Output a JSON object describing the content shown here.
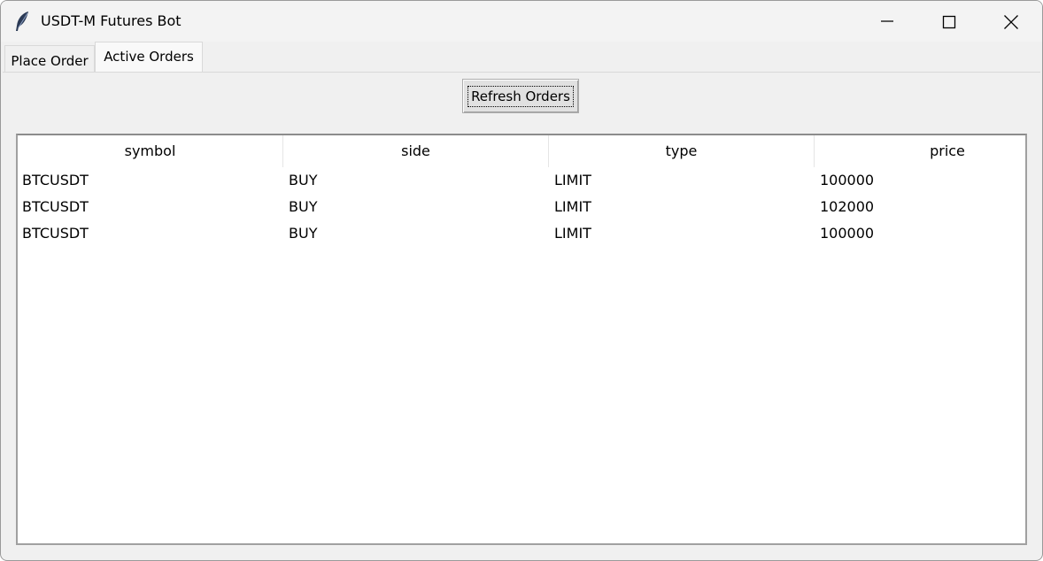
{
  "window": {
    "title": "USDT-M Futures Bot",
    "icon": "feather-icon"
  },
  "tabs": [
    {
      "label": "Place Order",
      "selected": false
    },
    {
      "label": "Active Orders",
      "selected": true
    }
  ],
  "toolbar": {
    "refresh_label": "Refresh Orders"
  },
  "orders_table": {
    "columns": [
      "symbol",
      "side",
      "type",
      "price"
    ],
    "rows": [
      [
        "BTCUSDT",
        "BUY",
        "LIMIT",
        "100000"
      ],
      [
        "BTCUSDT",
        "BUY",
        "LIMIT",
        "102000"
      ],
      [
        "BTCUSDT",
        "BUY",
        "LIMIT",
        "100000"
      ]
    ]
  }
}
